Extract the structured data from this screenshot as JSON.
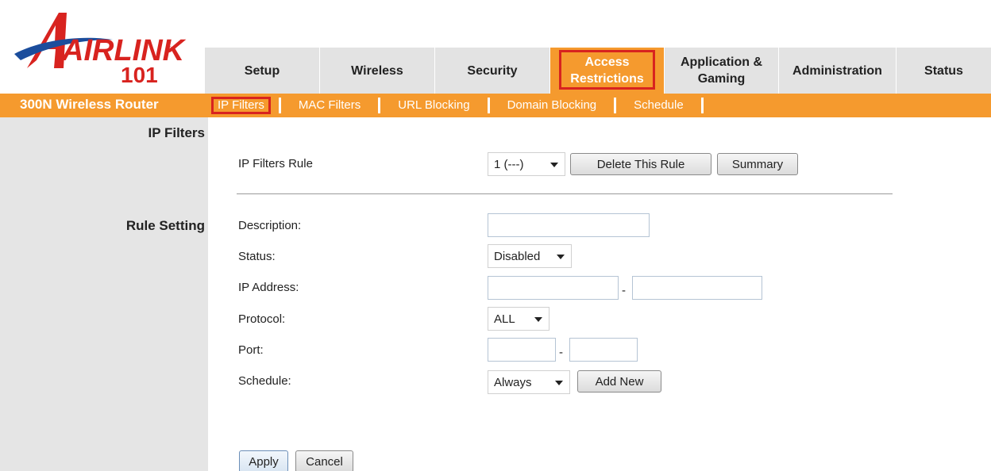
{
  "brand": {
    "logo_text": "AIRLINK",
    "logo_number": "101",
    "router_name": "300N Wireless Router"
  },
  "main_nav": [
    {
      "label": "Setup",
      "active": false
    },
    {
      "label": "Wireless",
      "active": false
    },
    {
      "label": "Security",
      "active": false
    },
    {
      "label": "Access\nRestrictions",
      "active": true
    },
    {
      "label": "Application &\nGaming",
      "active": false
    },
    {
      "label": "Administration",
      "active": false
    },
    {
      "label": "Status",
      "active": false
    }
  ],
  "sub_nav": [
    {
      "label": "IP Filters",
      "active": true
    },
    {
      "label": "MAC Filters",
      "active": false
    },
    {
      "label": "URL Blocking",
      "active": false
    },
    {
      "label": "Domain Blocking",
      "active": false
    },
    {
      "label": "Schedule",
      "active": false
    }
  ],
  "sections": {
    "ip_filters": "IP Filters",
    "rule_setting": "Rule Setting"
  },
  "ip_filters_rule": {
    "label": "IP Filters Rule",
    "selected": "1 (---)",
    "delete_button": "Delete This Rule",
    "summary_button": "Summary"
  },
  "form": {
    "description_label": "Description:",
    "description_value": "",
    "status_label": "Status:",
    "status_selected": "Disabled",
    "ip_address_label": "IP Address:",
    "ip_start": "",
    "ip_end": "",
    "protocol_label": "Protocol:",
    "protocol_selected": "ALL",
    "port_label": "Port:",
    "port_start": "",
    "port_end": "",
    "schedule_label": "Schedule:",
    "schedule_selected": "Always",
    "add_new_button": "Add New",
    "range_separator": "-"
  },
  "actions": {
    "apply": "Apply",
    "cancel": "Cancel"
  },
  "colors": {
    "accent_orange": "#f59a2e",
    "highlight_red": "#d8231f",
    "logo_red": "#d8231f",
    "logo_blue": "#1b4d9c",
    "sidebar_gray": "#e5e5e5"
  }
}
